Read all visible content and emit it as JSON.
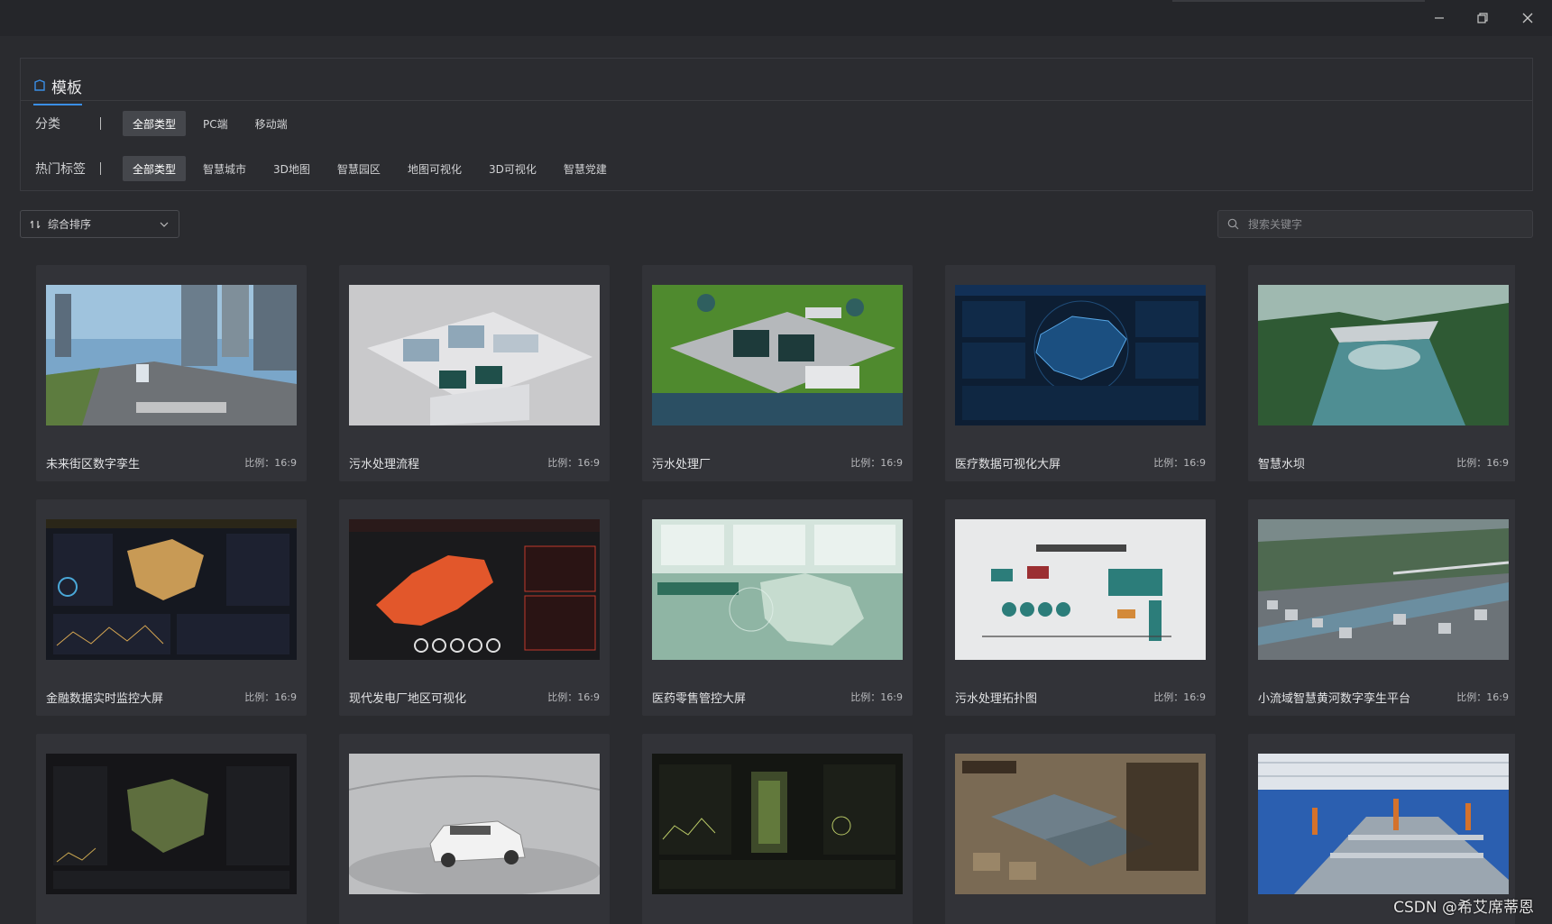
{
  "panel": {
    "title": "模板",
    "category_label": "分类",
    "categories": [
      "全部类型",
      "PC端",
      "移动端"
    ],
    "tag_label": "热门标签",
    "tags": [
      "全部类型",
      "智慧城市",
      "3D地图",
      "智慧园区",
      "地图可视化",
      "3D可视化",
      "智慧党建"
    ]
  },
  "toolbar": {
    "sort_label": "综合排序",
    "search_placeholder": "搜索关键字"
  },
  "cards": [
    {
      "name": "未来街区数字孪生",
      "ratio": "比例：16:9",
      "theme": "city"
    },
    {
      "name": "污水处理流程",
      "ratio": "比例：16:9",
      "theme": "plant-white"
    },
    {
      "name": "污水处理厂",
      "ratio": "比例：16:9",
      "theme": "plant-green"
    },
    {
      "name": "医疗数据可视化大屏",
      "ratio": "比例：16:9",
      "theme": "dashboard-blue"
    },
    {
      "name": "智慧水坝",
      "ratio": "比例：16:9",
      "theme": "dam"
    },
    {
      "name": "金融数据实时监控大屏",
      "ratio": "比例：16:9",
      "theme": "dashboard-gold"
    },
    {
      "name": "现代发电厂地区可视化",
      "ratio": "比例：16:9",
      "theme": "dashboard-red"
    },
    {
      "name": "医药零售管控大屏",
      "ratio": "比例：16:9",
      "theme": "dashboard-mint"
    },
    {
      "name": "污水处理拓扑图",
      "ratio": "比例：16:9",
      "theme": "topology"
    },
    {
      "name": "小流域智慧黄河数字孪生平台",
      "ratio": "比例：16:9",
      "theme": "town"
    },
    {
      "name": "",
      "ratio": "",
      "theme": "dashboard-dark"
    },
    {
      "name": "",
      "ratio": "",
      "theme": "car"
    },
    {
      "name": "",
      "ratio": "",
      "theme": "dashboard-olive"
    },
    {
      "name": "",
      "ratio": "",
      "theme": "village"
    },
    {
      "name": "",
      "ratio": "",
      "theme": "factory"
    }
  ],
  "watermark": "CSDN @希艾席蒂恩",
  "colors": {
    "accent": "#3a8ee6",
    "background": "#2a2b2f",
    "card": "#323338"
  }
}
